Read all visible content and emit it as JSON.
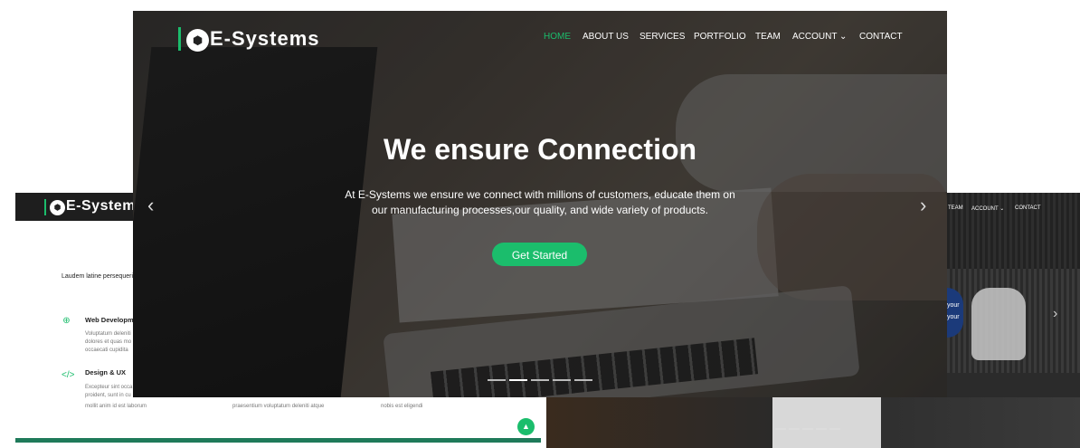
{
  "brand": "E-Systems",
  "accent": "#1bbd6c",
  "main": {
    "nav": [
      "HOME",
      "ABOUT US",
      "SERVICES",
      "PORTFOLIO",
      "TEAM",
      "ACCOUNT",
      "CONTACT"
    ],
    "active_nav": "HOME",
    "hero_title": "We ensure Connection",
    "hero_subtitle": "At E-Systems we ensure we connect with millions of customers, educate them on our manufacturing processes,our quality, and wide variety of products.",
    "cta_label": "Get Started",
    "slides": 5,
    "active_slide": 2
  },
  "left": {
    "brand": "E-Systems",
    "intro": "Laudem latine persequeri",
    "services": [
      {
        "icon": "globe-icon",
        "title": "Web Developm",
        "desc": [
          "Voluptatum deleniti",
          "dolores et quas mo",
          "occaecati cupidita"
        ]
      },
      {
        "icon": "code-icon",
        "title": "Design & UX",
        "desc": [
          "Excepteur sint occa",
          "proident, sunt in cu"
        ]
      }
    ],
    "footer_text": [
      "mollit anim id est laborum",
      "praesentium voluptatum deleniti atque",
      "nobis est eligendi"
    ]
  },
  "right": {
    "nav": [
      "TEAM",
      "ACCOUNT",
      "CONTACT"
    ],
    "hero_fragment": [
      "your",
      "your"
    ]
  }
}
